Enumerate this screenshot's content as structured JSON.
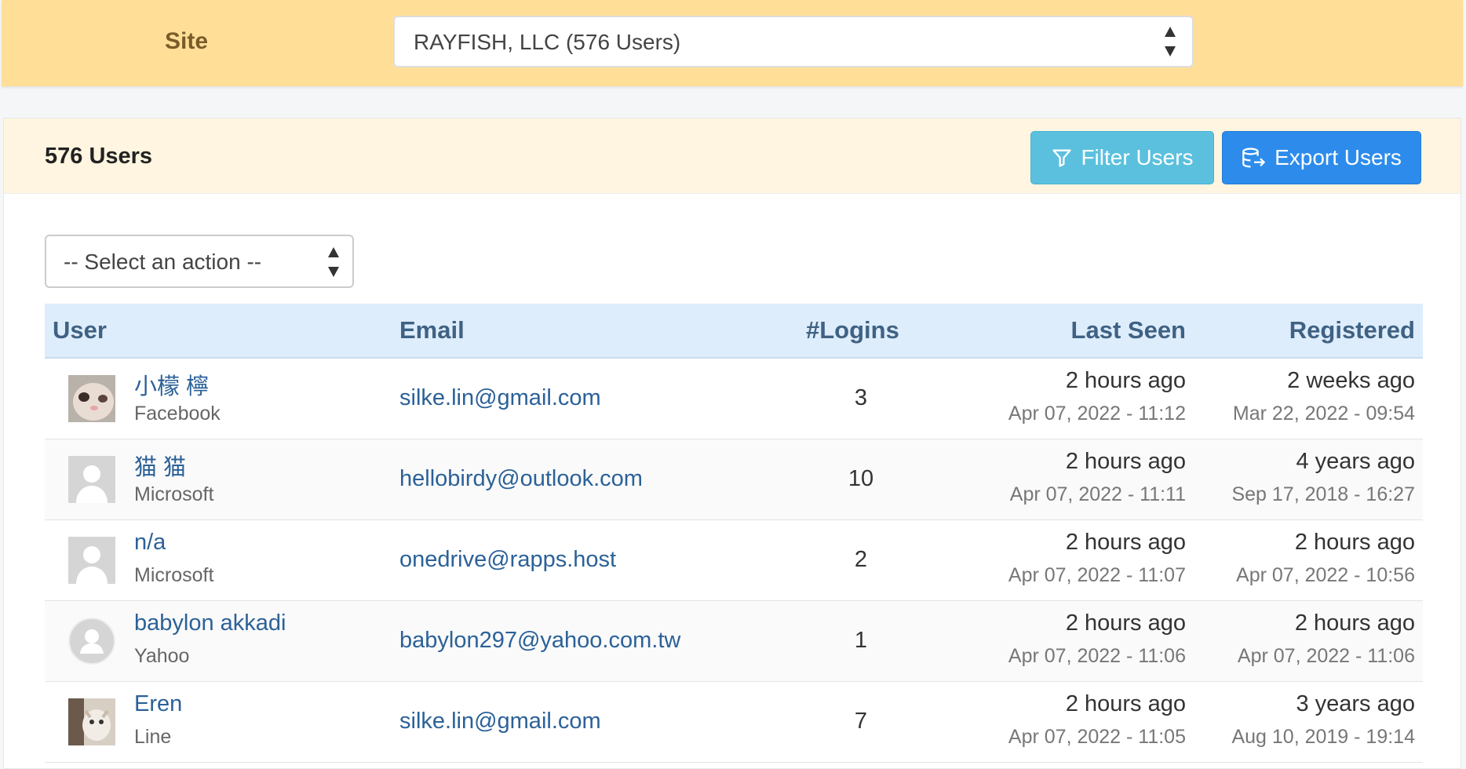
{
  "site": {
    "label": "Site",
    "selected": "RAYFISH, LLC (576 Users)"
  },
  "card": {
    "count_label": "576 Users",
    "filter_label": "Filter Users",
    "export_label": "Export Users",
    "action_select": "-- Select an action --"
  },
  "table": {
    "headers": {
      "user": "User",
      "email": "Email",
      "logins": "#Logins",
      "last_seen": "Last Seen",
      "registered": "Registered"
    },
    "rows": [
      {
        "name": "小檬 檸",
        "provider": "Facebook",
        "email": "silke.lin@gmail.com",
        "logins": "3",
        "last_seen_rel": "2 hours ago",
        "last_seen_abs": "Apr 07, 2022 - 11:12",
        "registered_rel": "2 weeks ago",
        "registered_abs": "Mar 22, 2022 - 09:54",
        "avatar": "cat-photo"
      },
      {
        "name": "猫 猫",
        "provider": "Microsoft",
        "email": "hellobirdy@outlook.com",
        "logins": "10",
        "last_seen_rel": "2 hours ago",
        "last_seen_abs": "Apr 07, 2022 - 11:11",
        "registered_rel": "4 years ago",
        "registered_abs": "Sep 17, 2018 - 16:27",
        "avatar": "default-square"
      },
      {
        "name": "n/a",
        "provider": "Microsoft",
        "email": "onedrive@rapps.host",
        "logins": "2",
        "last_seen_rel": "2 hours ago",
        "last_seen_abs": "Apr 07, 2022 - 11:07",
        "registered_rel": "2 hours ago",
        "registered_abs": "Apr 07, 2022 - 10:56",
        "avatar": "default-square"
      },
      {
        "name": "babylon akkadi",
        "provider": "Yahoo",
        "email": "babylon297@yahoo.com.tw",
        "logins": "1",
        "last_seen_rel": "2 hours ago",
        "last_seen_abs": "Apr 07, 2022 - 11:06",
        "registered_rel": "2 hours ago",
        "registered_abs": "Apr 07, 2022 - 11:06",
        "avatar": "default-round"
      },
      {
        "name": "Eren",
        "provider": "Line",
        "email": "silke.lin@gmail.com",
        "logins": "7",
        "last_seen_rel": "2 hours ago",
        "last_seen_abs": "Apr 07, 2022 - 11:05",
        "registered_rel": "3 years ago",
        "registered_abs": "Aug 10, 2019 - 19:14",
        "avatar": "kitten-photo"
      }
    ]
  },
  "colors": {
    "site_bar": "#ffdf98",
    "card_header": "#fff5e0",
    "filter_button": "#5bc0de",
    "export_button": "#2d8ceb",
    "link": "#2b6198",
    "table_header": "#deedfc"
  }
}
